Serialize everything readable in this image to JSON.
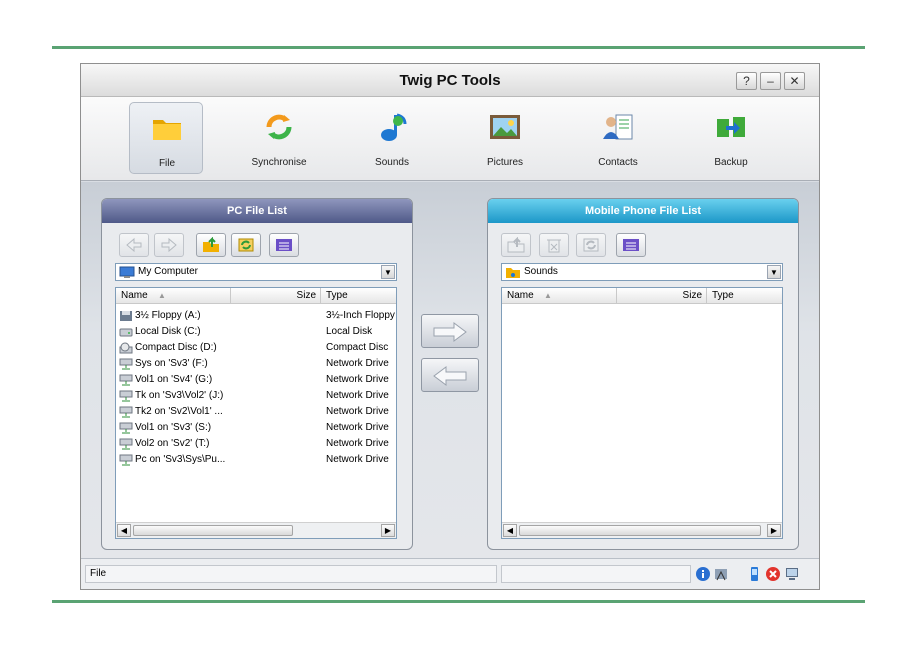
{
  "window": {
    "title": "Twig PC Tools",
    "controls": [
      "?",
      "–",
      "✕"
    ]
  },
  "toolbar": {
    "items": [
      {
        "label": "File",
        "icon": "folder-icon"
      },
      {
        "label": "Synchronise",
        "icon": "sync-icon"
      },
      {
        "label": "Sounds",
        "icon": "sounds-icon"
      },
      {
        "label": "Pictures",
        "icon": "pictures-icon"
      },
      {
        "label": "Contacts",
        "icon": "contacts-icon"
      },
      {
        "label": "Backup",
        "icon": "backup-icon"
      }
    ],
    "active": "File"
  },
  "pc_panel": {
    "title": "PC File List",
    "location": "My Computer",
    "columns": [
      "Name",
      "Size",
      "Type"
    ],
    "rows": [
      {
        "name": "3½ Floppy (A:)",
        "type": "3½-Inch Floppy",
        "icon": "floppy-icon"
      },
      {
        "name": "Local Disk (C:)",
        "type": "Local Disk",
        "icon": "disk-icon"
      },
      {
        "name": "Compact Disc (D:)",
        "type": "Compact Disc",
        "icon": "cd-icon"
      },
      {
        "name": "Sys on 'Sv3' (F:)",
        "type": "Network Drive",
        "icon": "network-drive-icon"
      },
      {
        "name": "Vol1 on 'Sv4' (G:)",
        "type": "Network Drive",
        "icon": "network-drive-icon"
      },
      {
        "name": "Tk on 'Sv3\\Vol2' (J:)",
        "type": "Network Drive",
        "icon": "network-drive-icon"
      },
      {
        "name": "Tk2 on 'Sv2\\Vol1' ...",
        "type": "Network Drive",
        "icon": "network-drive-icon"
      },
      {
        "name": "Vol1 on 'Sv3' (S:)",
        "type": "Network Drive",
        "icon": "network-drive-icon"
      },
      {
        "name": "Vol2 on 'Sv2' (T:)",
        "type": "Network Drive",
        "icon": "network-drive-icon"
      },
      {
        "name": "Pc on 'Sv3\\Sys\\Pu...",
        "type": "Network Drive",
        "icon": "network-drive-icon"
      }
    ]
  },
  "phone_panel": {
    "title": "Mobile Phone File List",
    "location": "Sounds",
    "columns": [
      "Name",
      "Size",
      "Type"
    ],
    "rows": []
  },
  "statusbar": {
    "text": "File"
  },
  "colors": {
    "rule": "#5aa373",
    "pc_header": "#4f5988",
    "phone_header": "#1c97c8"
  }
}
